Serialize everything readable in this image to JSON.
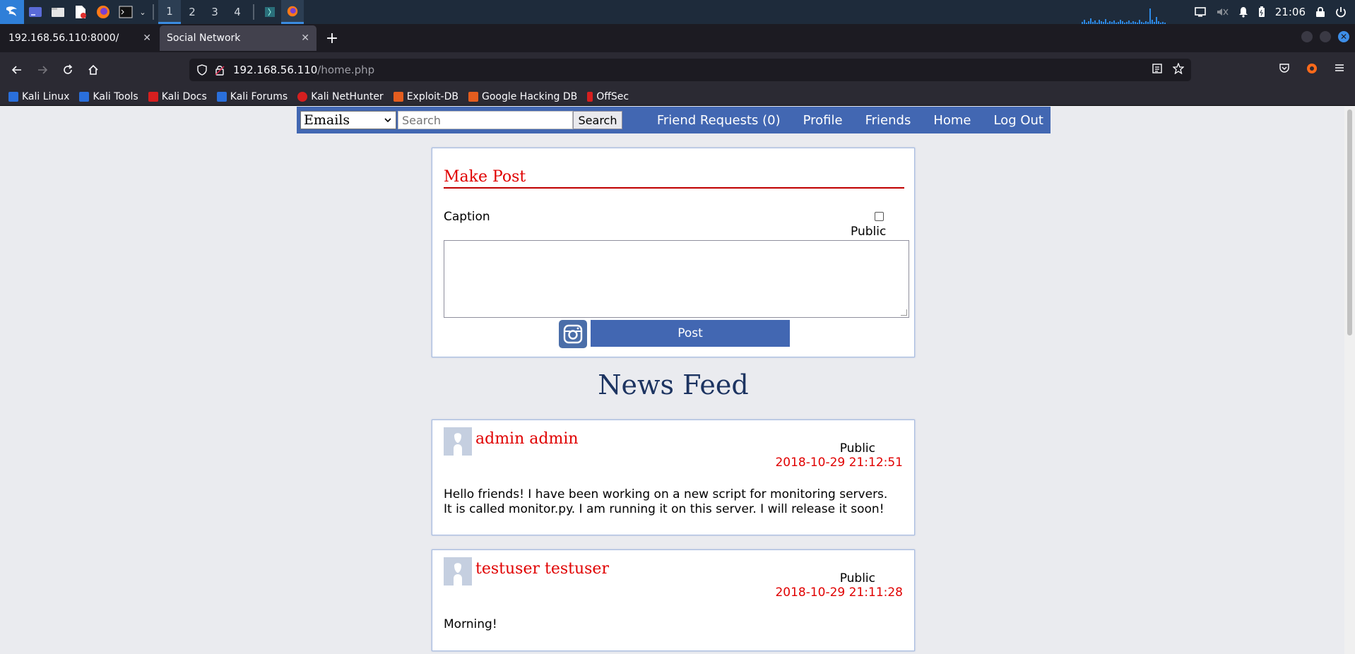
{
  "taskbar": {
    "workspaces": [
      "1",
      "2",
      "3",
      "4"
    ],
    "active_workspace": "1",
    "clock": "21:06"
  },
  "browser": {
    "tabs": [
      {
        "label": "192.168.56.110:8000/",
        "active": false
      },
      {
        "label": "Social Network",
        "active": true
      }
    ],
    "url_host": "192.168.56.110",
    "url_path": "/home.php",
    "bookmarks": [
      {
        "label": "Kali Linux",
        "color": "#2a6fdb"
      },
      {
        "label": "Kali Tools",
        "color": "#2a6fdb"
      },
      {
        "label": "Kali Docs",
        "color": "#d61f1f"
      },
      {
        "label": "Kali Forums",
        "color": "#2a6fdb"
      },
      {
        "label": "Kali NetHunter",
        "color": "#d61f1f"
      },
      {
        "label": "Exploit-DB",
        "color": "#e35d1f"
      },
      {
        "label": "Google Hacking DB",
        "color": "#e35d1f"
      },
      {
        "label": "OffSec",
        "color": "#d61f1f"
      }
    ]
  },
  "site": {
    "search_type": "Emails",
    "search_placeholder": "Search",
    "search_button": "Search",
    "nav_links": [
      "Friend Requests (0)",
      "Profile",
      "Friends",
      "Home",
      "Log Out"
    ]
  },
  "make_post": {
    "title": "Make Post",
    "caption_label": "Caption",
    "public_label": "Public",
    "post_button": "Post"
  },
  "feed": {
    "title": "News Feed",
    "posts": [
      {
        "author": "admin admin",
        "visibility": "Public",
        "date": "2018-10-29 21:12:51",
        "body": "Hello friends! I have been working on a new script for monitoring servers. It is called monitor.py. I am running it on this server. I will release it soon!"
      },
      {
        "author": "testuser testuser",
        "visibility": "Public",
        "date": "2018-10-29 21:11:28",
        "body": "Morning!"
      }
    ]
  },
  "colors": {
    "site_blue": "#4267b2",
    "accent_red": "#e00000",
    "page_bg": "#eaebef"
  }
}
